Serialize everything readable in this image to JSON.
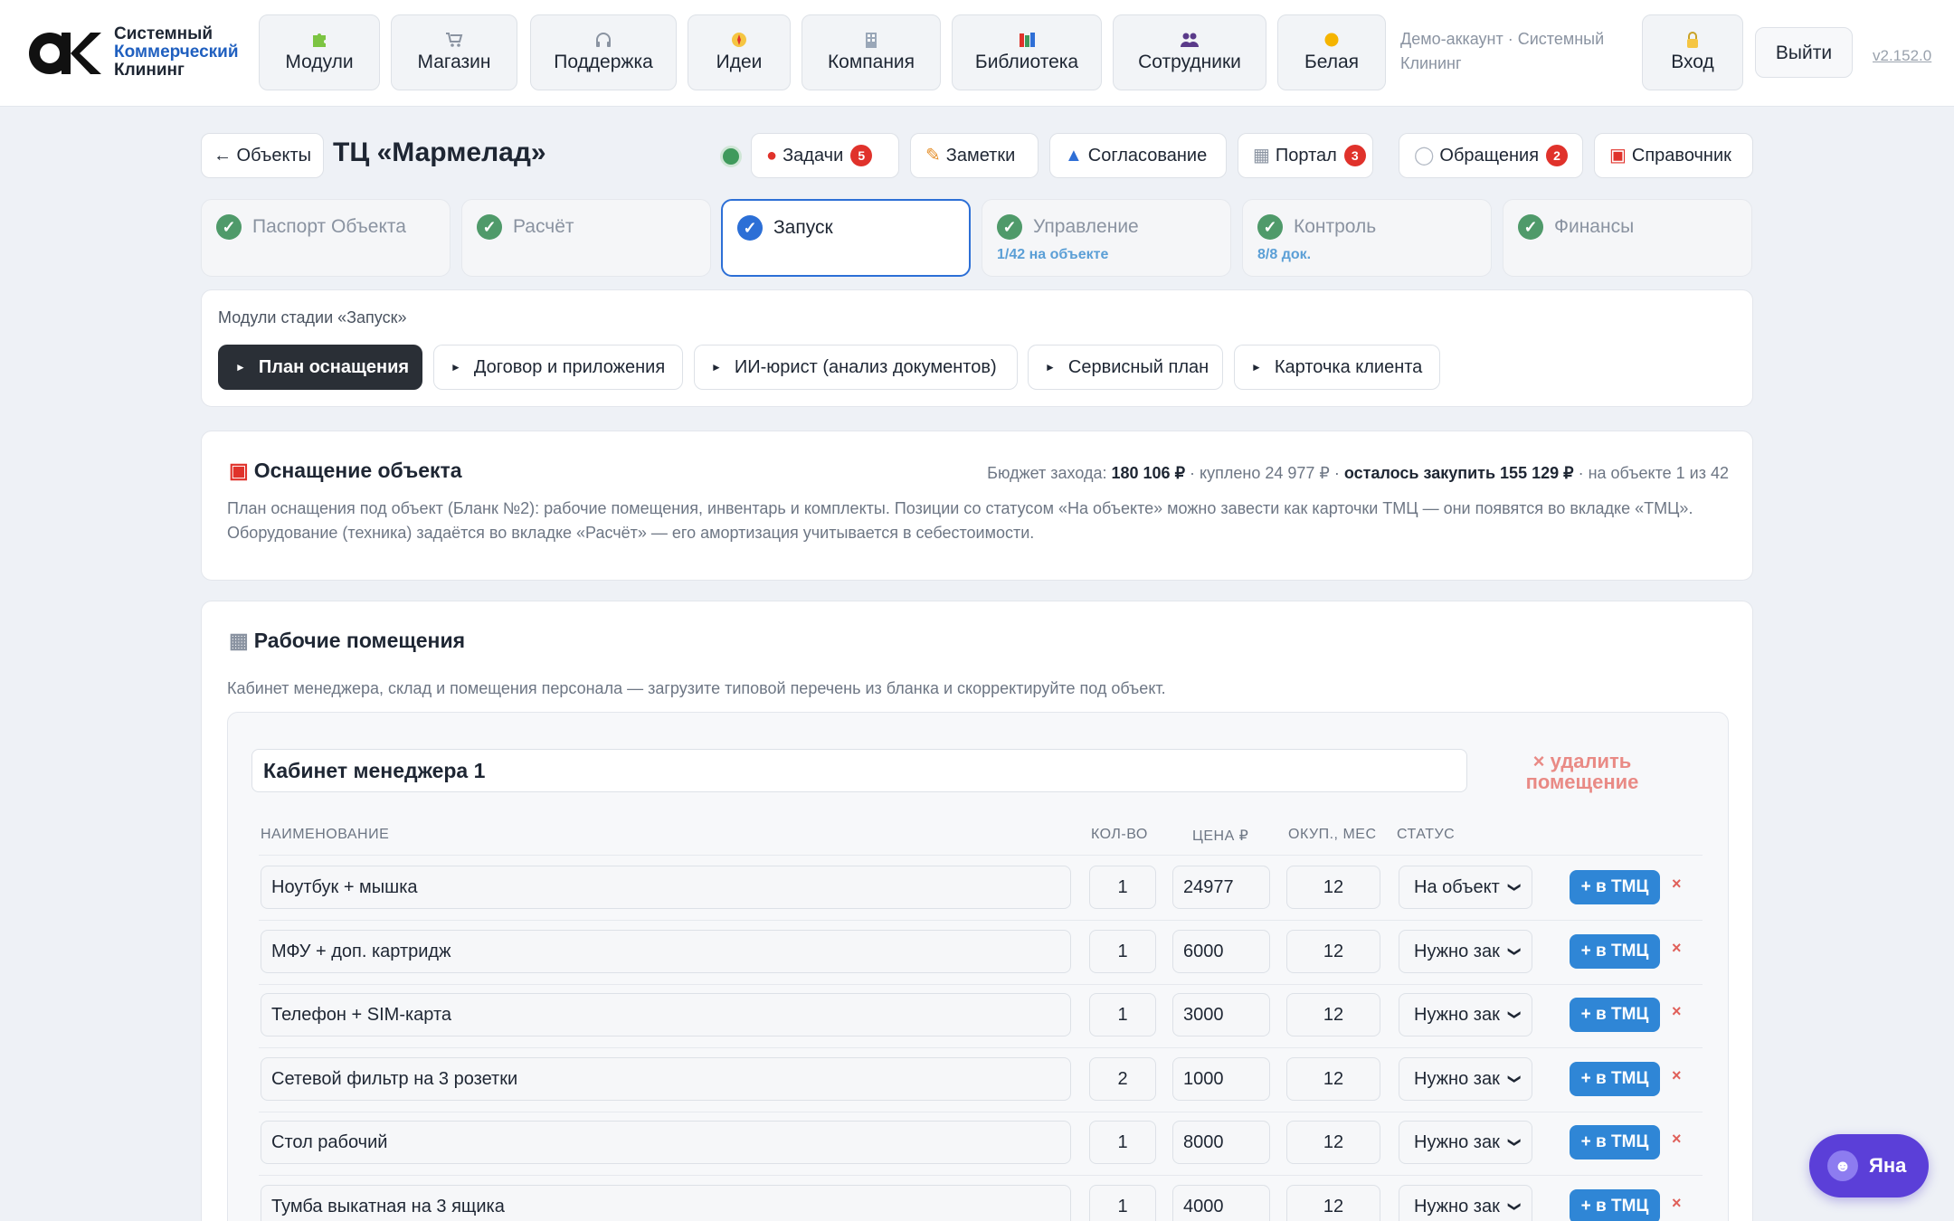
{
  "header": {
    "logo_lines": [
      "Системный",
      "Коммерческий",
      "Клининг"
    ],
    "nav": [
      {
        "label": "Модули",
        "icon": "puzzle-icon"
      },
      {
        "label": "Магазин",
        "icon": "cart-icon"
      },
      {
        "label": "Поддержка",
        "icon": "headphones-icon"
      },
      {
        "label": "Идеи",
        "icon": "compass-icon"
      },
      {
        "label": "Компания",
        "icon": "building-icon"
      },
      {
        "label": "Библиотека",
        "icon": "books-icon"
      },
      {
        "label": "Сотрудники",
        "icon": "people-icon"
      },
      {
        "label": "Белая",
        "icon": "sun-icon"
      }
    ],
    "account": "Демо-аккаунт · Системный Клининг",
    "login": {
      "label": "Вход",
      "icon": "lock-icon"
    },
    "logout": "Выйти",
    "version": "v2.152.0"
  },
  "object": {
    "back": "← Объекты",
    "title": "ТЦ «Мармелад»",
    "status_color": "#3f9a5c",
    "actions": [
      {
        "label": "Задачи",
        "icon": "pin-icon",
        "badge": "5"
      },
      {
        "label": "Заметки",
        "icon": "memo-icon",
        "badge": ""
      },
      {
        "label": "Согласование",
        "icon": "stamp-icon",
        "badge": ""
      },
      {
        "label": "Портал",
        "icon": "office-icon",
        "badge": "3"
      },
      {
        "label": "Обращения",
        "icon": "speech-icon",
        "badge": "2"
      },
      {
        "label": "Справочник",
        "icon": "toolbox-icon",
        "badge": ""
      }
    ]
  },
  "stages": [
    {
      "name": "Паспорт Объекта",
      "sub": "",
      "active": false
    },
    {
      "name": "Расчёт",
      "sub": "",
      "active": false
    },
    {
      "name": "Запуск",
      "sub": "",
      "active": true
    },
    {
      "name": "Управление",
      "sub": "1/42 на объекте",
      "active": false
    },
    {
      "name": "Контроль",
      "sub": "8/8 док.",
      "active": false
    },
    {
      "name": "Финансы",
      "sub": "",
      "active": false
    }
  ],
  "modules": {
    "title": "Модули стадии «Запуск»",
    "items": [
      "План оснащения",
      "Договор и приложения",
      "ИИ-юрист (анализ документов)",
      "Сервисный план",
      "Карточка клиента"
    ]
  },
  "equipment": {
    "title": "Оснащение объекта",
    "icon": "toolbox-icon",
    "budget_label": "Бюджет захода:",
    "budget_value": "180 106 ₽",
    "bought": "· куплено 24 977 ₽ ·",
    "remaining": "осталось закупить 155 129 ₽",
    "on_object": "· на объекте 1 из 42",
    "desc1": "План оснащения под объект (Бланк №2): рабочие помещения, инвентарь и комплекты. Позиции со статусом «На объекте» можно завести как карточки ТМЦ — они появятся во вкладке «ТМЦ».",
    "desc2": "Оборудование (техника) задаётся во вкладке «Расчёт» — его амортизация учитывается в себестоимости."
  },
  "rooms": {
    "title": "Рабочие помещения",
    "icon": "office-icon",
    "desc": "Кабинет менеджера, склад и помещения персонала — загрузите типовой перечень из бланка и скорректируйте под объект.",
    "room_name": "Кабинет менеджера 1",
    "delete_room": "× удалить помещение",
    "columns": {
      "name": "НАИМЕНОВАНИЕ",
      "qty": "КОЛ-ВО",
      "price": "ЦЕНА ₽",
      "payback": "ОКУП., МЕС",
      "status": "СТАТУС"
    },
    "to_tmc": "+ в ТМЦ",
    "rows": [
      {
        "name": "Ноутбук + мышка",
        "qty": "1",
        "price": "24977",
        "payback": "12",
        "status": "На объект"
      },
      {
        "name": "МФУ + доп. картридж",
        "qty": "1",
        "price": "6000",
        "payback": "12",
        "status": "Нужно зак"
      },
      {
        "name": "Телефон + SIM-карта",
        "qty": "1",
        "price": "3000",
        "payback": "12",
        "status": "Нужно зак"
      },
      {
        "name": "Сетевой фильтр на 3 розетки",
        "qty": "2",
        "price": "1000",
        "payback": "12",
        "status": "Нужно зак"
      },
      {
        "name": "Стол рабочий",
        "qty": "1",
        "price": "8000",
        "payback": "12",
        "status": "Нужно зак"
      },
      {
        "name": "Тумба выкатная на 3 ящика",
        "qty": "1",
        "price": "4000",
        "payback": "12",
        "status": "Нужно зак"
      }
    ]
  },
  "assistant": {
    "label": "Яна"
  }
}
